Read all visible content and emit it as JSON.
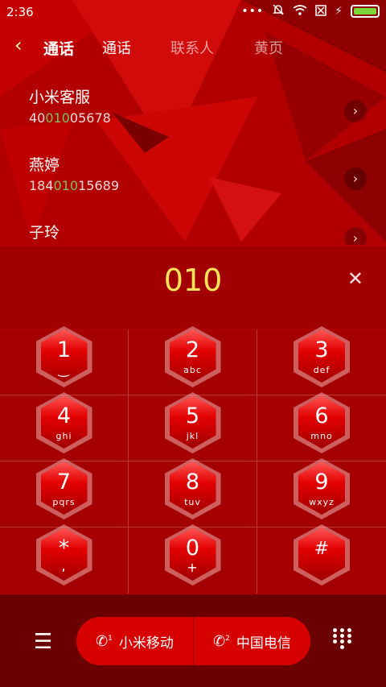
{
  "status": {
    "time": "2:36"
  },
  "nav": {
    "back_icon": "chevron-left-icon",
    "title": "通话",
    "tabs": [
      "通话",
      "联系人",
      "黄页"
    ]
  },
  "contacts": [
    {
      "name": "小米客服",
      "number_pre": "40",
      "number_match": "010",
      "number_post": "05678"
    },
    {
      "name": "燕婷",
      "number_pre": "184",
      "number_match": "010",
      "number_post": "15689"
    },
    {
      "name": "子玲",
      "number_pre": "",
      "number_match": "",
      "number_post": ""
    }
  ],
  "dialer": {
    "digits": "010",
    "clear_icon": "close-icon"
  },
  "keys": [
    {
      "digit": "1",
      "letters": ""
    },
    {
      "digit": "2",
      "letters": "abc"
    },
    {
      "digit": "3",
      "letters": "def"
    },
    {
      "digit": "4",
      "letters": "ghi"
    },
    {
      "digit": "5",
      "letters": "jkl"
    },
    {
      "digit": "6",
      "letters": "mno"
    },
    {
      "digit": "7",
      "letters": "pqrs"
    },
    {
      "digit": "8",
      "letters": "tuv"
    },
    {
      "digit": "9",
      "letters": "wxyz"
    },
    {
      "digit": "*",
      "letters": ","
    },
    {
      "digit": "0",
      "letters": "+"
    },
    {
      "digit": "#",
      "letters": ""
    }
  ],
  "bottom": {
    "sim1": {
      "label": "小米移动",
      "num": "1"
    },
    "sim2": {
      "label": "中国电信",
      "num": "2"
    }
  },
  "colors": {
    "accent_yellow": "#ffe45a",
    "highlight_green": "#7bc25b",
    "battery_green": "#7bd83a"
  }
}
